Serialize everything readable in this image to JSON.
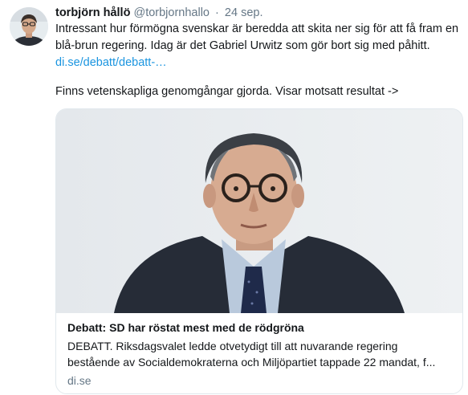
{
  "tweet": {
    "display_name": "torbjörn hållö",
    "handle": "@torbjornhallo",
    "separator": "·",
    "date": "24 sep.",
    "text_line1": "Intressant hur förmögna svenskar är beredda att skita ner sig för att få fram en",
    "text_line2": "blå-brun regering. Idag är det Gabriel Urwitz som gör bort sig med påhitt.",
    "link": "di.se/debatt/debatt-…",
    "text_para2": "Finns vetenskapliga genomgångar gjorda. Visar motsatt resultat ->"
  },
  "card": {
    "title": "Debatt: SD har röstat mest med de rödgröna",
    "description_line1": "DEBATT. Riksdagsvalet ledde otvetydigt till att nuvarande regering",
    "description_line2": "bestående av Socialdemokraterna och Miljöpartiet tappade 22 mandat, f...",
    "domain": "di.se"
  },
  "icons": {
    "avatar": "profile-photo",
    "card_image": "portrait-photo"
  },
  "colors": {
    "link": "#1b95e0",
    "muted": "#657786",
    "text": "#14171a",
    "border": "#e1e8ed"
  }
}
